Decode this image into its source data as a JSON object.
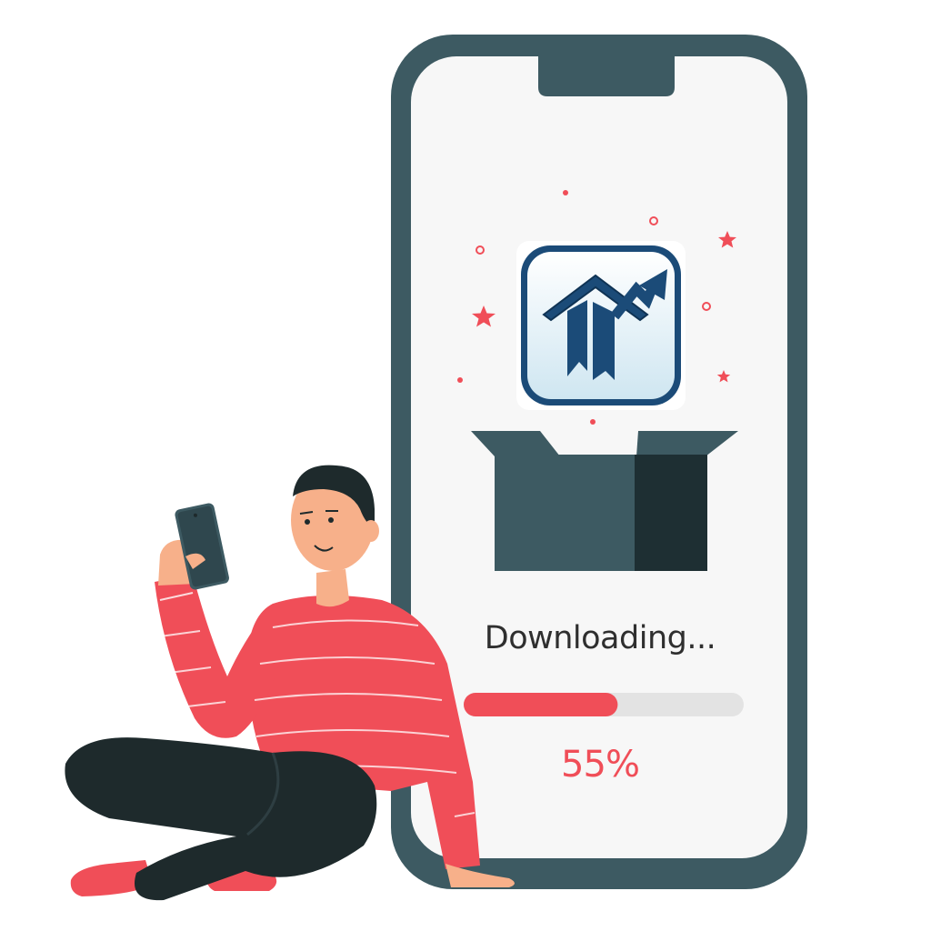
{
  "download": {
    "status_text": "Downloading...",
    "percent_label": "55%",
    "progress": 0.55
  },
  "app_icon": {
    "name": "app-logo-icon"
  },
  "colors": {
    "phone_frame": "#3d5a62",
    "screen": "#f7f7f7",
    "accent_red": "#f04e58",
    "progress_track": "#e3e3e3",
    "box_front": "#3d5a62",
    "box_side": "#1e2f33",
    "logo_navy": "#1b4b78",
    "logo_bg_top": "#ffffff",
    "logo_bg_bottom": "#d2e8f2"
  }
}
